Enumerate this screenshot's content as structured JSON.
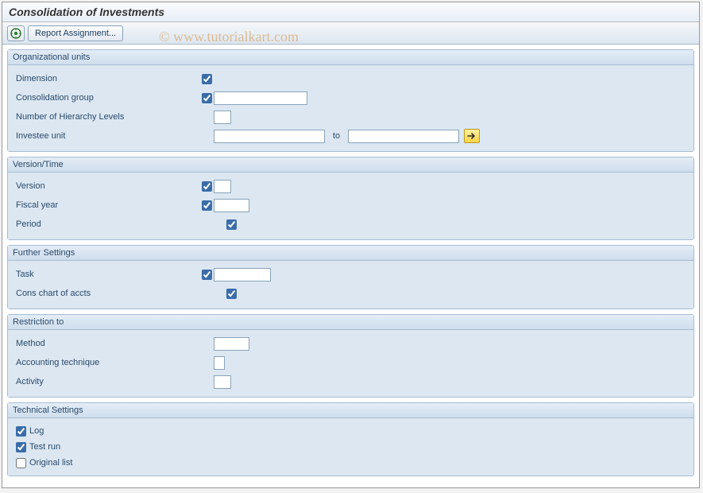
{
  "title": "Consolidation of Investments",
  "toolbar": {
    "report_assignment": "Report Assignment..."
  },
  "watermark": "© www.tutorialkart.com",
  "groups": {
    "org": {
      "title": "Organizational units",
      "dimension": "Dimension",
      "cons_group": "Consolidation group",
      "num_levels": "Number of Hierarchy Levels",
      "investee": "Investee unit",
      "to": "to"
    },
    "version_time": {
      "title": "Version/Time",
      "version": "Version",
      "fiscal_year": "Fiscal year",
      "period": "Period"
    },
    "further": {
      "title": "Further Settings",
      "task": "Task",
      "cons_chart": "Cons chart of accts"
    },
    "restriction": {
      "title": "Restriction to",
      "method": "Method",
      "acct_tech": "Accounting technique",
      "activity": "Activity"
    },
    "technical": {
      "title": "Technical Settings",
      "log": "Log",
      "test_run": "Test run",
      "orig_list": "Original list"
    }
  },
  "values": {
    "dimension_cb": true,
    "cons_group_cb": true,
    "cons_group_val": "",
    "num_levels_val": "",
    "investee_from": "",
    "investee_to": "",
    "version_cb": true,
    "version_val": "",
    "fiscal_year_cb": true,
    "fiscal_year_val": "",
    "period_cb": true,
    "task_cb": true,
    "task_val": "",
    "cons_chart_cb": true,
    "method_val": "",
    "acct_tech_val": "",
    "activity_val": "",
    "log_cb": true,
    "test_run_cb": true,
    "orig_list_cb": false
  }
}
